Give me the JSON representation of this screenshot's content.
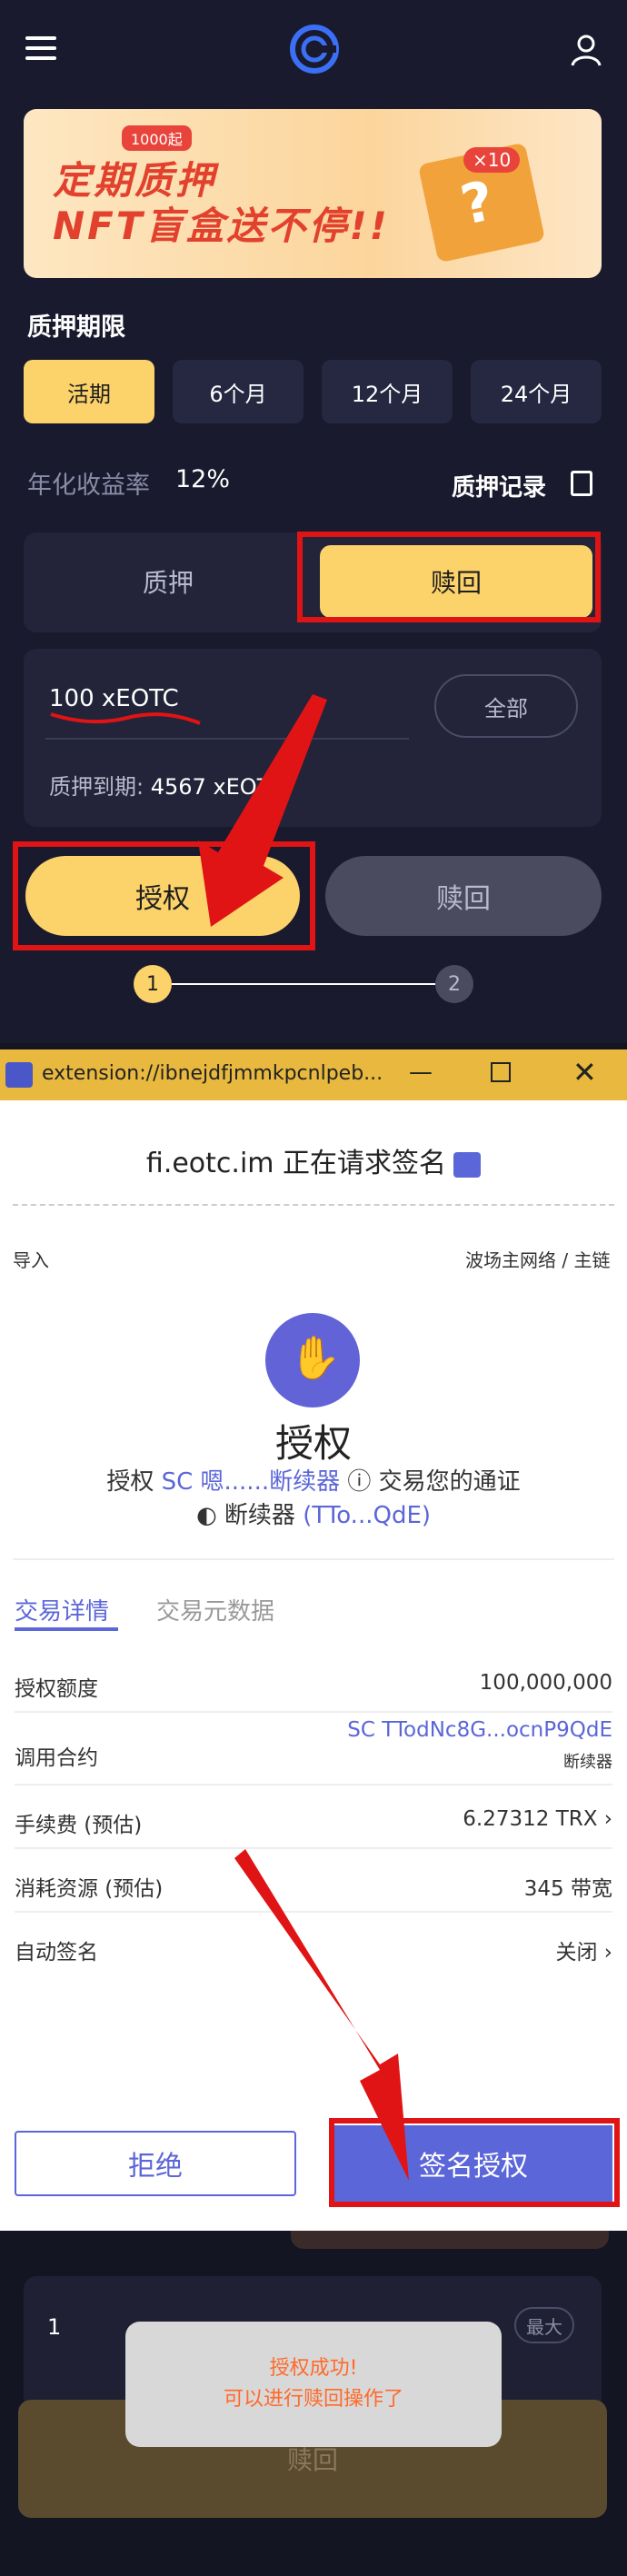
{
  "app": {
    "banner": {
      "badge": "1000起",
      "line1": "定期质押",
      "line2": "NFT盲盒送不停!!",
      "multiplier": "×10",
      "box_mark": "?"
    },
    "term_label": "质押期限",
    "terms": [
      "活期",
      "6个月",
      "12个月",
      "24个月"
    ],
    "apy_label": "年化收益率",
    "apy_value": "12%",
    "records_label": "质押记录",
    "segments": {
      "stake": "质押",
      "redeem": "赎回"
    },
    "amount": "100 xEOTC",
    "all_label": "全部",
    "expire_label": "质押到期:",
    "expire_value": "4567 xEOTC",
    "auth_button": "授权",
    "redeem_button": "赎回",
    "steps": [
      "1",
      "2"
    ]
  },
  "popup": {
    "window_title": "extension://ibnejdfjmmkpcnlpeb...",
    "request": "fi.eotc.im 正在请求签名",
    "import": "导入",
    "network": "波场主网络 / 主链",
    "title": "授权",
    "desc_prefix": "授权",
    "desc_token": "SC 嗯......断续器",
    "desc_suffix": "交易您的通证",
    "desc_line2_name": "断续器",
    "desc_line2_addr": "(TTo...QdE)",
    "tab_details": "交易详情",
    "tab_meta": "交易元数据",
    "rows": {
      "amount_k": "授权额度",
      "amount_v": "100,000,000",
      "contract_k": "调用合约",
      "contract_v": "SC TTodNc8G...ocnP9QdE",
      "contract_sub": "断续器",
      "fee_k": "手续费 (预估)",
      "fee_v": "6.27312 TRX",
      "res_k": "消耗资源 (预估)",
      "res_v": "345 带宽",
      "auto_k": "自动签名",
      "auto_v": "关闭"
    },
    "reject": "拒绝",
    "sign": "签名授权"
  },
  "bottom": {
    "amount": "1",
    "max_label": "最大",
    "toast1": "授权成功!",
    "toast2": "可以进行赎回操作了",
    "redeem_button": "赎回"
  }
}
